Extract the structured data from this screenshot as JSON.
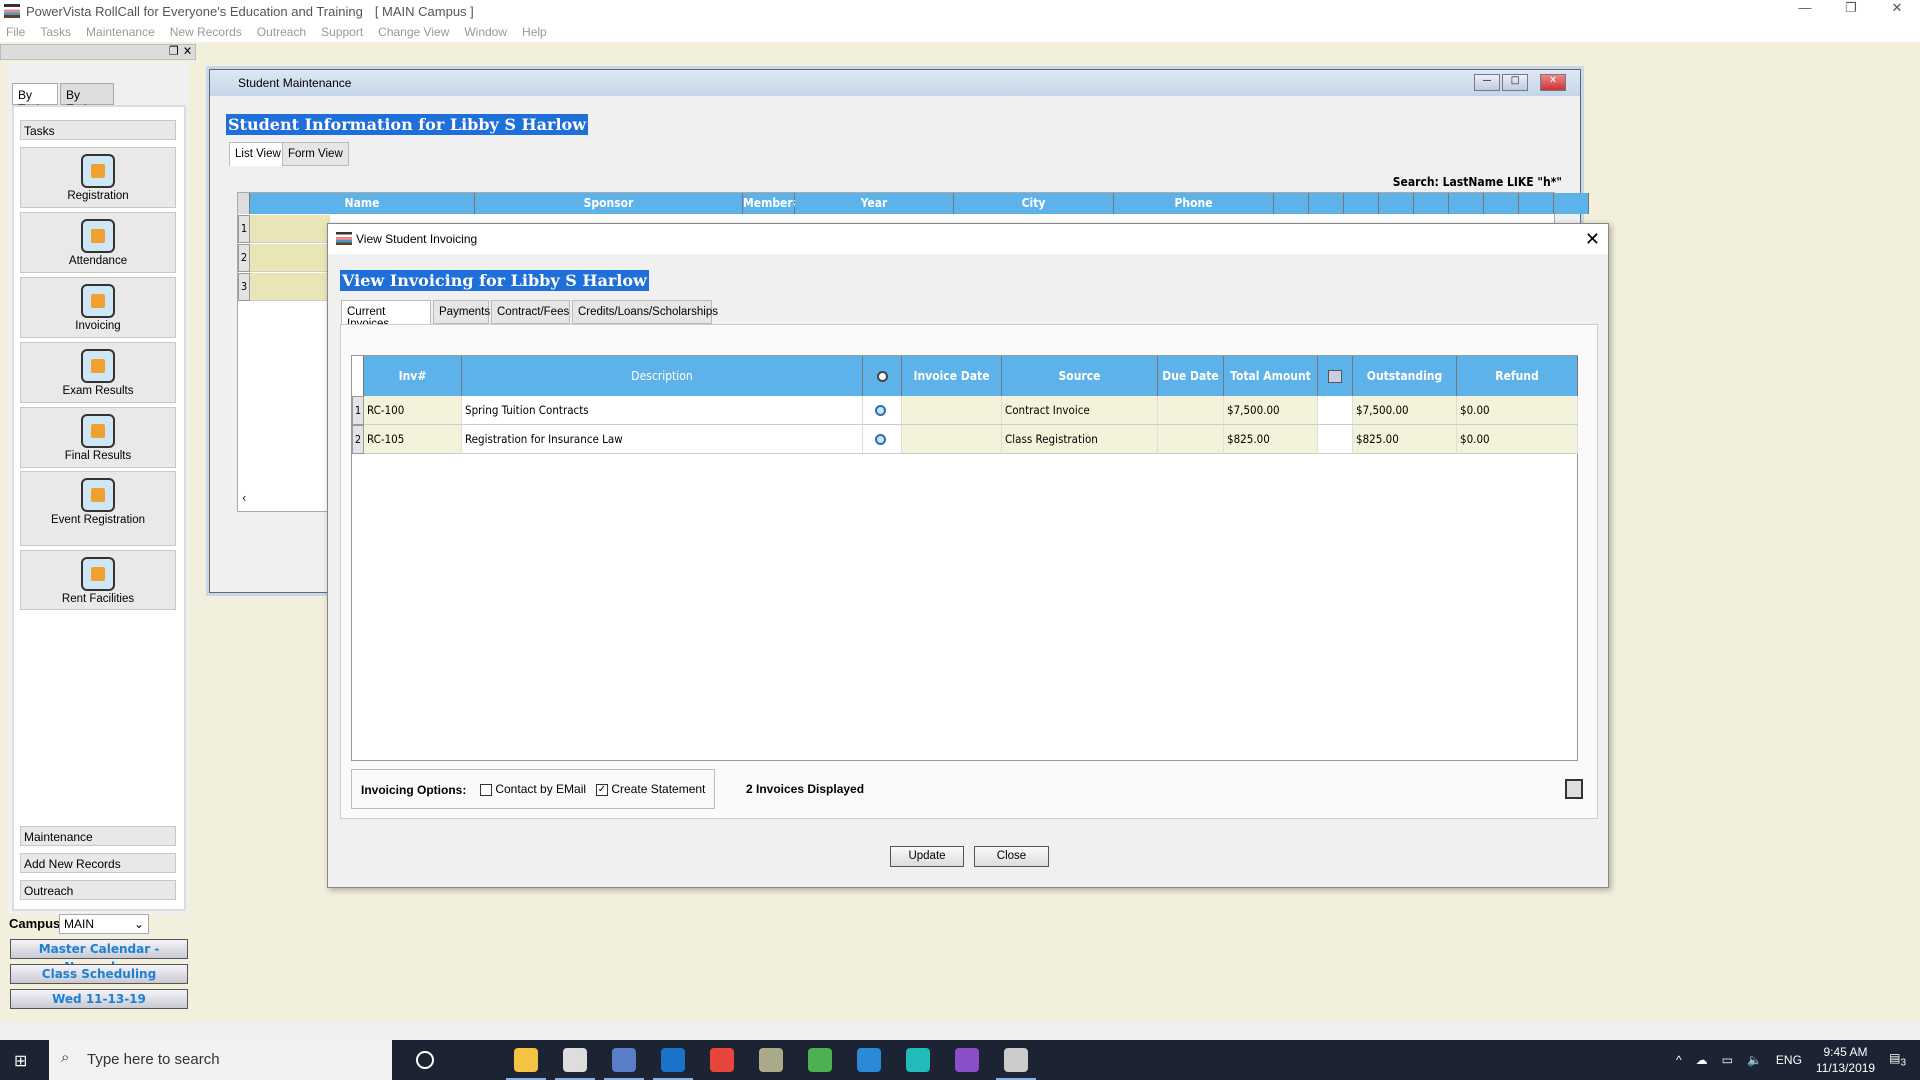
{
  "app": {
    "title": "PowerVista RollCall for Everyone's Education and Training",
    "campus_tag": "[ MAIN Campus ]",
    "window_controls": [
      "—",
      "❐",
      "✕"
    ]
  },
  "menu": [
    "File",
    "Tasks",
    "Maintenance",
    "New Records",
    "Outreach",
    "Support",
    "Change View",
    "Window",
    "Help"
  ],
  "sidebar": {
    "tabs": [
      "By Task",
      "By Entity"
    ],
    "tasks_label": "Tasks",
    "tasks": [
      {
        "label": "Registration",
        "icon": "registration-icon"
      },
      {
        "label": "Attendance",
        "icon": "attendance-icon"
      },
      {
        "label": "Invoicing",
        "icon": "invoicing-icon"
      },
      {
        "label": "Exam Results",
        "icon": "exam-results-icon"
      },
      {
        "label": "Final Results",
        "icon": "final-results-icon"
      },
      {
        "label": "Event Registration",
        "icon": "event-registration-icon"
      },
      {
        "label": "Rent Facilities",
        "icon": "rent-facilities-icon"
      }
    ],
    "sections": [
      "Maintenance",
      "Add New Records",
      "Outreach"
    ],
    "campus_label": "Campus",
    "campus_value": "MAIN",
    "nav_buttons": [
      "Master Calendar - November",
      "Class Scheduling",
      "Wed 11-13-19"
    ]
  },
  "student_maintenance": {
    "title": "Student Maintenance",
    "heading": "Student Information  for Libby S Harlow",
    "tabs": [
      "List View",
      "Form View"
    ],
    "search": "Search: LastName  LIKE  \"h*\"",
    "columns": [
      "Name",
      "Sponsor",
      "Member#",
      "Year",
      "City",
      "Phone"
    ],
    "row_numbers": [
      "1",
      "2",
      "3"
    ]
  },
  "invoicing": {
    "title": "View Student Invoicing",
    "heading": "View Invoicing for Libby S Harlow",
    "tabs": [
      "Current Invoices",
      "Payments",
      "Contract/Fees",
      "Credits/Loans/Scholarships"
    ],
    "columns": [
      "Inv#",
      "Description",
      "",
      "Invoice Date",
      "Source",
      "Due Date",
      "Total Amount",
      "",
      "Outstanding",
      "Refund"
    ],
    "rows": [
      {
        "num": "1",
        "inv": "RC-100",
        "description": "Spring Tuition Contracts",
        "invoice_date": "",
        "source": "Contract Invoice",
        "due_date": "",
        "total": "$7,500.00",
        "outstanding": "$7,500.00",
        "refund": "$0.00"
      },
      {
        "num": "2",
        "inv": "RC-105",
        "description": "Registration for Insurance Law",
        "invoice_date": "",
        "source": "Class Registration",
        "due_date": "",
        "total": "$825.00",
        "outstanding": "$825.00",
        "refund": "$0.00"
      }
    ],
    "options_label": "Invoicing Options:",
    "contact_by_email": {
      "label": "Contact by EMail",
      "checked": false
    },
    "create_statement": {
      "label": "Create Statement",
      "checked": true
    },
    "count_text": "2 Invoices Displayed",
    "update_label": "Update",
    "close_label": "Close"
  },
  "taskbar": {
    "search_placeholder": "Type here to search",
    "lang": "ENG",
    "time": "9:45 AM",
    "date": "11/13/2019",
    "notifications": "3"
  },
  "colors": {
    "header_blue": "#5eb2ea",
    "heading_highlight": "#1e6fd9",
    "row_beige": "#f3f3dc",
    "nav_text": "#1e7fd6"
  }
}
